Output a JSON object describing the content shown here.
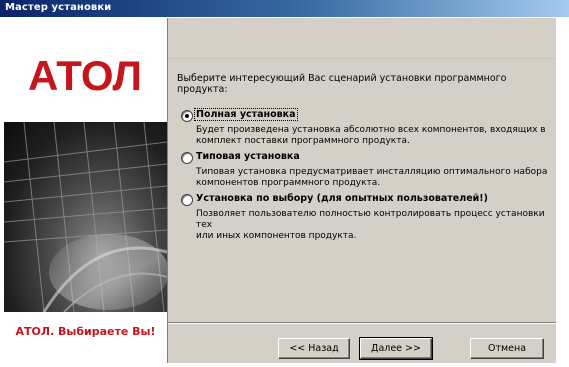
{
  "window": {
    "title": "Мастер установки"
  },
  "sidebar": {
    "logo_text": "АТОЛ",
    "slogan": "АТОЛ. Выбираете Вы!",
    "brand_color": "#c4161c"
  },
  "main": {
    "prompt": "Выберите интересующий Вас сценарий установки программного продукта:",
    "options": [
      {
        "label": "Полная установка",
        "selected": true,
        "desc_line1": "Будет произведена установка абсолютно всех компонентов, входящих в",
        "desc_line2": "комплект поставки программного продукта."
      },
      {
        "label": "Типовая установка",
        "selected": false,
        "desc_line1": "Типовая установка предусматривает инсталляцию оптимального набора",
        "desc_line2": "компонентов программного продукта."
      },
      {
        "label": "Установка по выбору (для опытных пользователей!)",
        "selected": false,
        "desc_line1": "Позволяет пользователю полностью контролировать процесс установки тех",
        "desc_line2": "или иных компонентов продукта."
      }
    ]
  },
  "footer": {
    "back_label": "<< Назад",
    "next_label": "Далее >>",
    "cancel_label": "Отмена"
  }
}
